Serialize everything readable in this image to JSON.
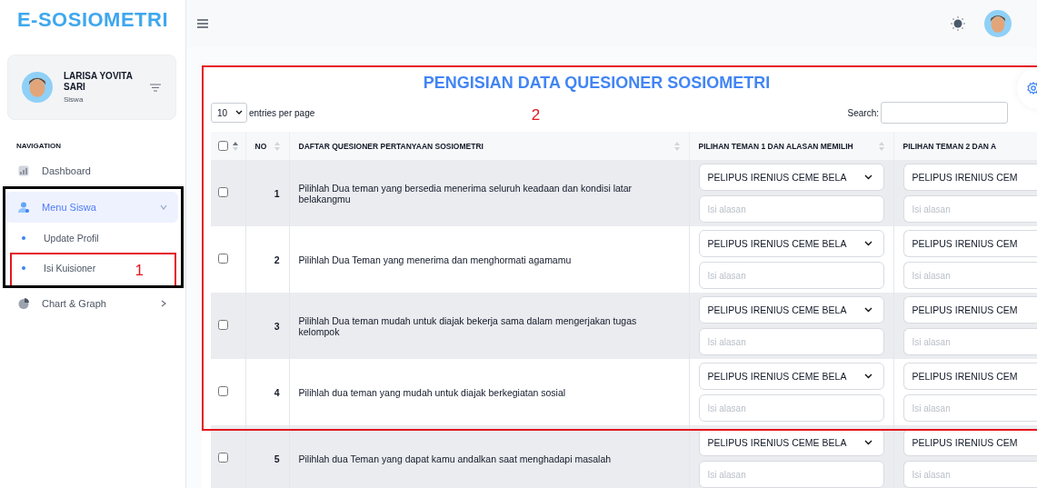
{
  "sidebar": {
    "logo": "E-SOSIOMETRI",
    "profile": {
      "name": "LARISA YOVITA SARI",
      "role": "Siswa"
    },
    "section_label": "NAVIGATION",
    "items": [
      {
        "label": "Dashboard",
        "selected": false
      },
      {
        "label": "Menu Siswa",
        "selected": true,
        "expanded": true,
        "annotation": {
          "color": "#000000"
        },
        "children": [
          {
            "label": "Update Profil",
            "selected": false
          },
          {
            "label": "Isi Kuisioner",
            "selected": false,
            "annotation": {
              "label": "1",
              "color": "#e5161f"
            }
          }
        ]
      },
      {
        "label": "Chart & Graph",
        "selected": false,
        "expanded": false
      }
    ]
  },
  "card": {
    "title": "PENGISIAN DATA QUESIONER SOSIOMETRI",
    "annotation": {
      "label": "2",
      "color": "#e5161f"
    },
    "page_size": "10",
    "page_size_label": "entries per page",
    "search_label": "Search:",
    "table": {
      "columns": [
        {
          "kind": "check",
          "checked": false,
          "sorted": true
        },
        {
          "kind": "text",
          "label": "NO",
          "sorted": false
        },
        {
          "kind": "text",
          "label": "DAFTAR QUESIONER PERTANYAAN SOSIOMETRI",
          "sorted": false
        },
        {
          "kind": "text",
          "label": "PILIHAN TEMAN 1 DAN ALASAN MEMILIH",
          "sorted": false
        },
        {
          "kind": "text",
          "label": "PILIHAN TEMAN 2 DAN A"
        }
      ],
      "rows": [
        {
          "checked": false,
          "no": "1",
          "question": "Pilihlah Dua teman yang bersedia menerima seluruh keadaan dan kondisi latar belakangmu",
          "choices": [
            {
              "value": "PELIPUS IRENIUS CEME BELA",
              "placeholder": "Isi alasan"
            },
            {
              "value": "PELIPUS IRENIUS CEM",
              "placeholder": "Isi alasan"
            }
          ]
        },
        {
          "checked": false,
          "no": "2",
          "question": "Pilihlah Dua Teman yang menerima dan menghormati agamamu",
          "choices": [
            {
              "value": "PELIPUS IRENIUS CEME BELA",
              "placeholder": "Isi alasan"
            },
            {
              "value": "PELIPUS IRENIUS CEM",
              "placeholder": "Isi alasan"
            }
          ]
        },
        {
          "checked": false,
          "no": "3",
          "question": "Pilihlah Dua teman mudah untuk diajak bekerja sama dalam mengerjakan tugas kelompok",
          "choices": [
            {
              "value": "PELIPUS IRENIUS CEME BELA",
              "placeholder": "Isi alasan"
            },
            {
              "value": "PELIPUS IRENIUS CEM",
              "placeholder": "Isi alasan"
            }
          ]
        },
        {
          "checked": false,
          "no": "4",
          "question": "Pilihlah dua teman yang mudah untuk diajak berkegiatan sosial",
          "choices": [
            {
              "value": "PELIPUS IRENIUS CEME BELA",
              "placeholder": "Isi alasan"
            },
            {
              "value": "PELIPUS IRENIUS CEM",
              "placeholder": "Isi alasan"
            }
          ]
        },
        {
          "checked": false,
          "no": "5",
          "question": "Pilihlah dua Teman yang dapat kamu andalkan saat menghadapi masalah",
          "choices": [
            {
              "value": "PELIPUS IRENIUS CEME BELA",
              "placeholder": "Isi alasan"
            },
            {
              "value": "PELIPUS IRENIUS CEM",
              "placeholder": "Isi alasan"
            }
          ]
        }
      ]
    }
  }
}
